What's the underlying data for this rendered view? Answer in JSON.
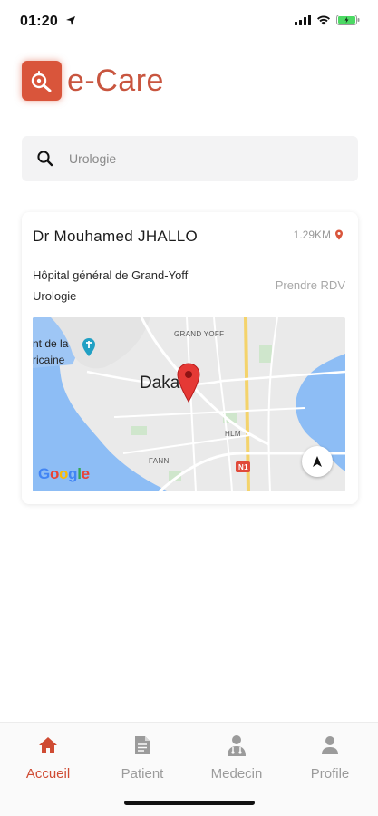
{
  "status_bar": {
    "time": "01:20"
  },
  "header": {
    "title": "e-Care"
  },
  "search": {
    "value": "Urologie"
  },
  "card": {
    "doctor_name": "Dr  Mouhamed JHALLO",
    "distance": "1.29KM",
    "hospital": "Hôpital général de Grand-Yoff",
    "specialty": "Urologie",
    "action_label": "Prendre RDV",
    "map": {
      "labels": {
        "grand_yoff": "GRAND YOFF",
        "hlm": "HLM",
        "fann": "FANN",
        "city": "Dakar",
        "fragment_1": "nt de la",
        "fragment_2": "ricaine",
        "road_sign": "N1",
        "provider": "Google"
      }
    }
  },
  "nav": {
    "items": [
      {
        "label": "Accueil",
        "icon": "home-icon",
        "active": true
      },
      {
        "label": "Patient",
        "icon": "document-icon",
        "active": false
      },
      {
        "label": "Medecin",
        "icon": "doctor-icon",
        "active": false
      },
      {
        "label": "Profile",
        "icon": "user-icon",
        "active": false
      }
    ],
    "active_color": "#cf4b33",
    "inactive_color": "#9b9b9b"
  },
  "colors": {
    "brand": "#d9553b",
    "brand_text": "#c8553f"
  }
}
